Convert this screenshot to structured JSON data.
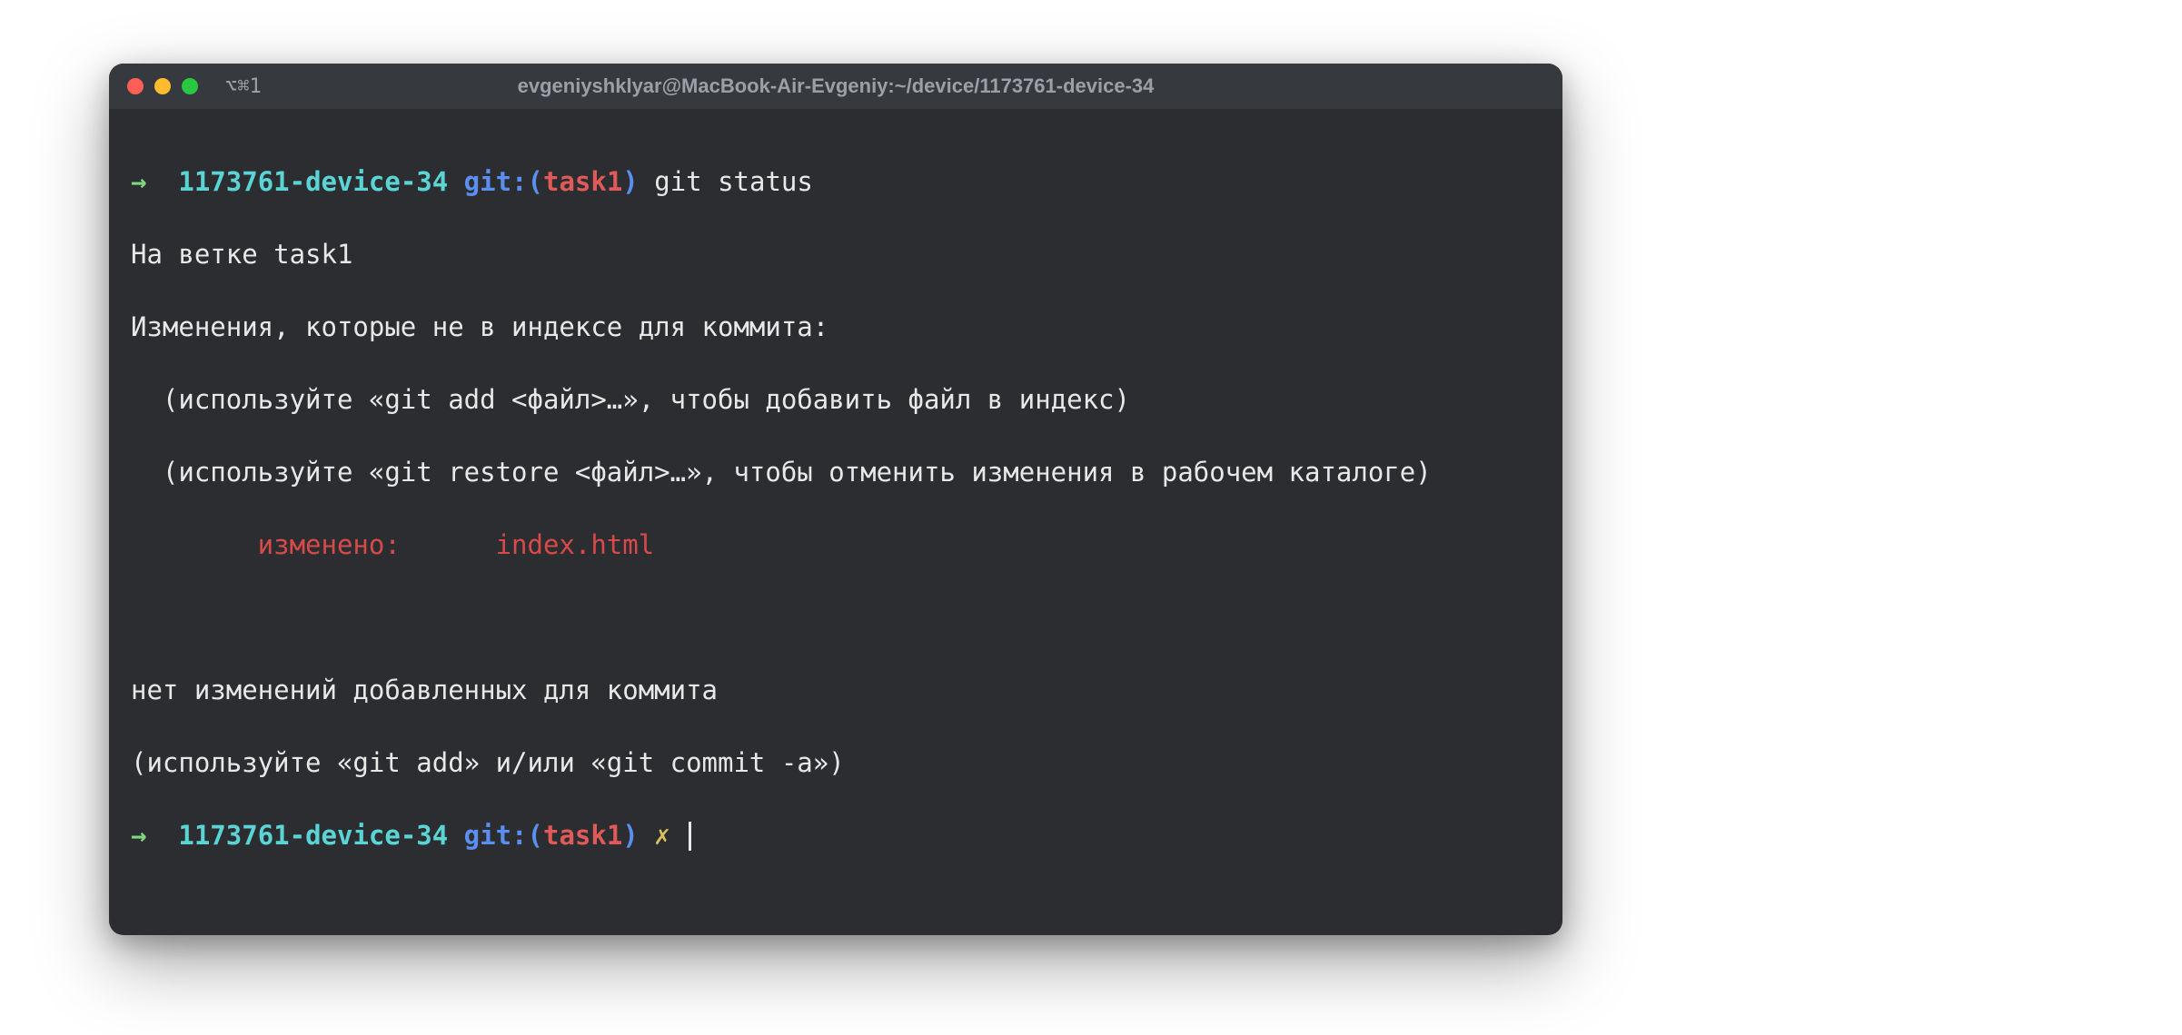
{
  "titlebar": {
    "shortcut": "⌥⌘1",
    "title": "evgeniyshklyar@MacBook-Air-Evgeniy:~/device/1173761-device-34"
  },
  "prompt1": {
    "arrow": "→",
    "dir": "1173761-device-34",
    "git_label": "git:(",
    "branch": "task1",
    "git_close": ")",
    "command": "git status"
  },
  "output": {
    "line1": "На ветке task1",
    "line2": "Изменения, которые не в индексе для коммита:",
    "line3": "  (используйте «git add <файл>…», чтобы добавить файл в индекс)",
    "line4": "  (используйте «git restore <файл>…», чтобы отменить изменения в рабочем каталоге)",
    "modified_label": "        изменено:      ",
    "modified_file": "index.html",
    "line6": "нет изменений добавленных для коммита",
    "line7": "(используйте «git add» и/или «git commit -a»)"
  },
  "prompt2": {
    "arrow": "→",
    "dir": "1173761-device-34",
    "git_label": "git:(",
    "branch": "task1",
    "git_close": ")",
    "dirty": "✗"
  }
}
